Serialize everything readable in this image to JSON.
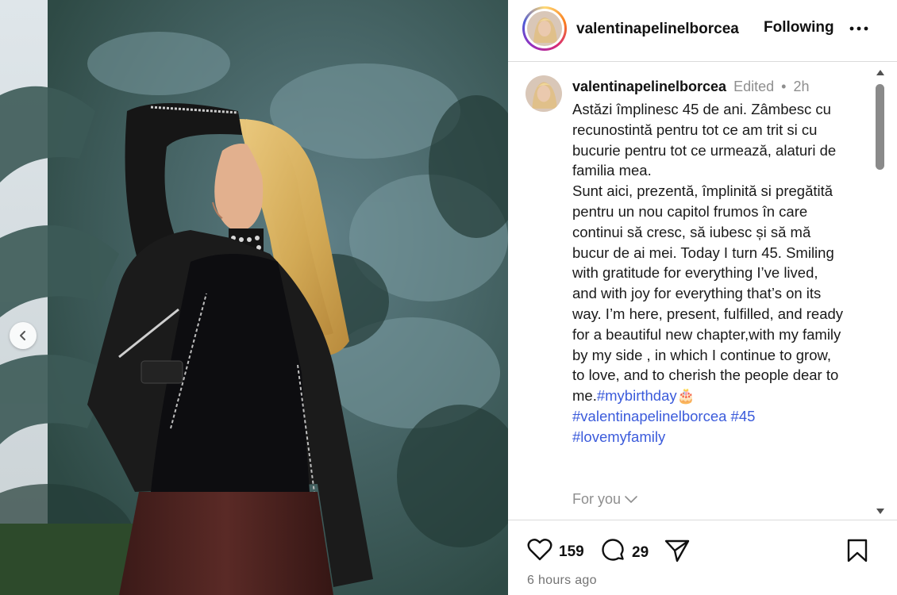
{
  "photo": {
    "prev_icon": "chevron-left-icon"
  },
  "header": {
    "username": "valentinapelinelborcea",
    "follow_label": "Following",
    "more_icon": "more-horizontal-icon",
    "ring_colors": [
      "#feda75",
      "#fa7e1e",
      "#d62976",
      "#962fbf",
      "#4f5bd5"
    ]
  },
  "caption": {
    "username": "valentinapelinelborcea",
    "edited": "Edited",
    "separator": "•",
    "time": "2h",
    "paragraph1": "Astăzi împlinesc 45 de ani. Zâmbesc cu recunostintă pentru tot ce am trit si cu bucurie pentru tot ce urmează, alaturi de familia mea.",
    "paragraph2": "Sunt aici, prezentă, împlinită si pregătită pentru un nou capitol frumos în care continui să cresc, să iubesc și să mă bucur de ai mei.  Today I turn 45. Smiling with gratitude for everything I’ve lived, and with joy for everything that’s on its way. I’m here, present, fulfilled, and ready for a beautiful new chapter,with my family by my side , in which I continue to grow, to love, and to cherish the people dear to me.",
    "hashtags": [
      "#mybirthday",
      "#valentinapelinelborcea",
      "#45",
      "#lovemyfamily"
    ],
    "birthday_emoji": "🎂",
    "hashtag_color": "#3b5bdb"
  },
  "for_you": {
    "label": "For you",
    "icon": "chevron-down-icon"
  },
  "actions": {
    "likes": "159",
    "comments": "29",
    "like_icon": "heart-icon",
    "comment_icon": "comment-icon",
    "share_icon": "send-icon",
    "save_icon": "bookmark-icon"
  },
  "timestamp": "6 hours ago"
}
